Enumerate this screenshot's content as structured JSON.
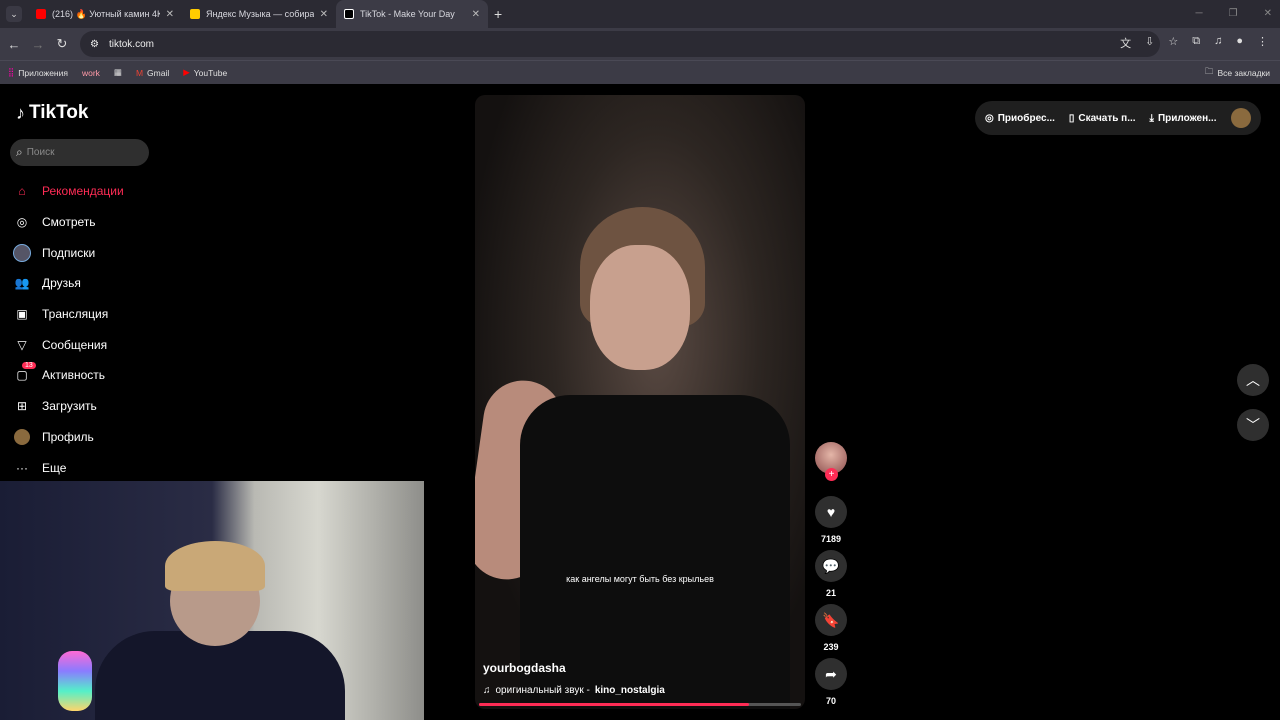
{
  "tabs": [
    {
      "title": "(216) 🔥 Уютный камин 4К (12",
      "fav_color": "#ff0000"
    },
    {
      "title": "Яндекс Музыка — собираем м",
      "fav_color": "#ffcc00"
    },
    {
      "title": "TikTok - Make Your Day",
      "fav_color": "#000000"
    }
  ],
  "address": {
    "url": "tiktok.com"
  },
  "bookmarks": {
    "apps": "Приложения",
    "work": "work",
    "gmail": "Gmail",
    "youtube": "YouTube",
    "all": "Все закладки"
  },
  "tiktok": {
    "logo": "TikTok",
    "search_placeholder": "Поиск",
    "menu": [
      {
        "label": "Рекомендации",
        "icon": "home-icon"
      },
      {
        "label": "Смотреть",
        "icon": "compass-icon"
      },
      {
        "label": "Подписки",
        "icon": "following-avatar-icon"
      },
      {
        "label": "Друзья",
        "icon": "friends-icon"
      },
      {
        "label": "Трансляция",
        "icon": "live-icon"
      },
      {
        "label": "Сообщения",
        "icon": "send-icon"
      },
      {
        "label": "Активность",
        "icon": "activity-icon",
        "badge": "13"
      },
      {
        "label": "Загрузить",
        "icon": "upload-icon"
      },
      {
        "label": "Профиль",
        "icon": "profile-icon"
      },
      {
        "label": "Еще",
        "icon": "more-icon"
      }
    ],
    "top_actions": {
      "buy": "Приобрес...",
      "download": "Скачать п...",
      "app": "Приложен..."
    },
    "video": {
      "caption": "как ангелы могут быть без крыльев",
      "author": "yourbogdasha",
      "sound_prefix": "оригинальный звук -",
      "sound_name": "kino_nostalgia",
      "progress_percent": 84
    },
    "counts": {
      "likes": "7189",
      "comments": "21",
      "saves": "239",
      "shares": "70"
    }
  },
  "colors": {
    "accent": "#fe2c55",
    "background": "#000000"
  }
}
